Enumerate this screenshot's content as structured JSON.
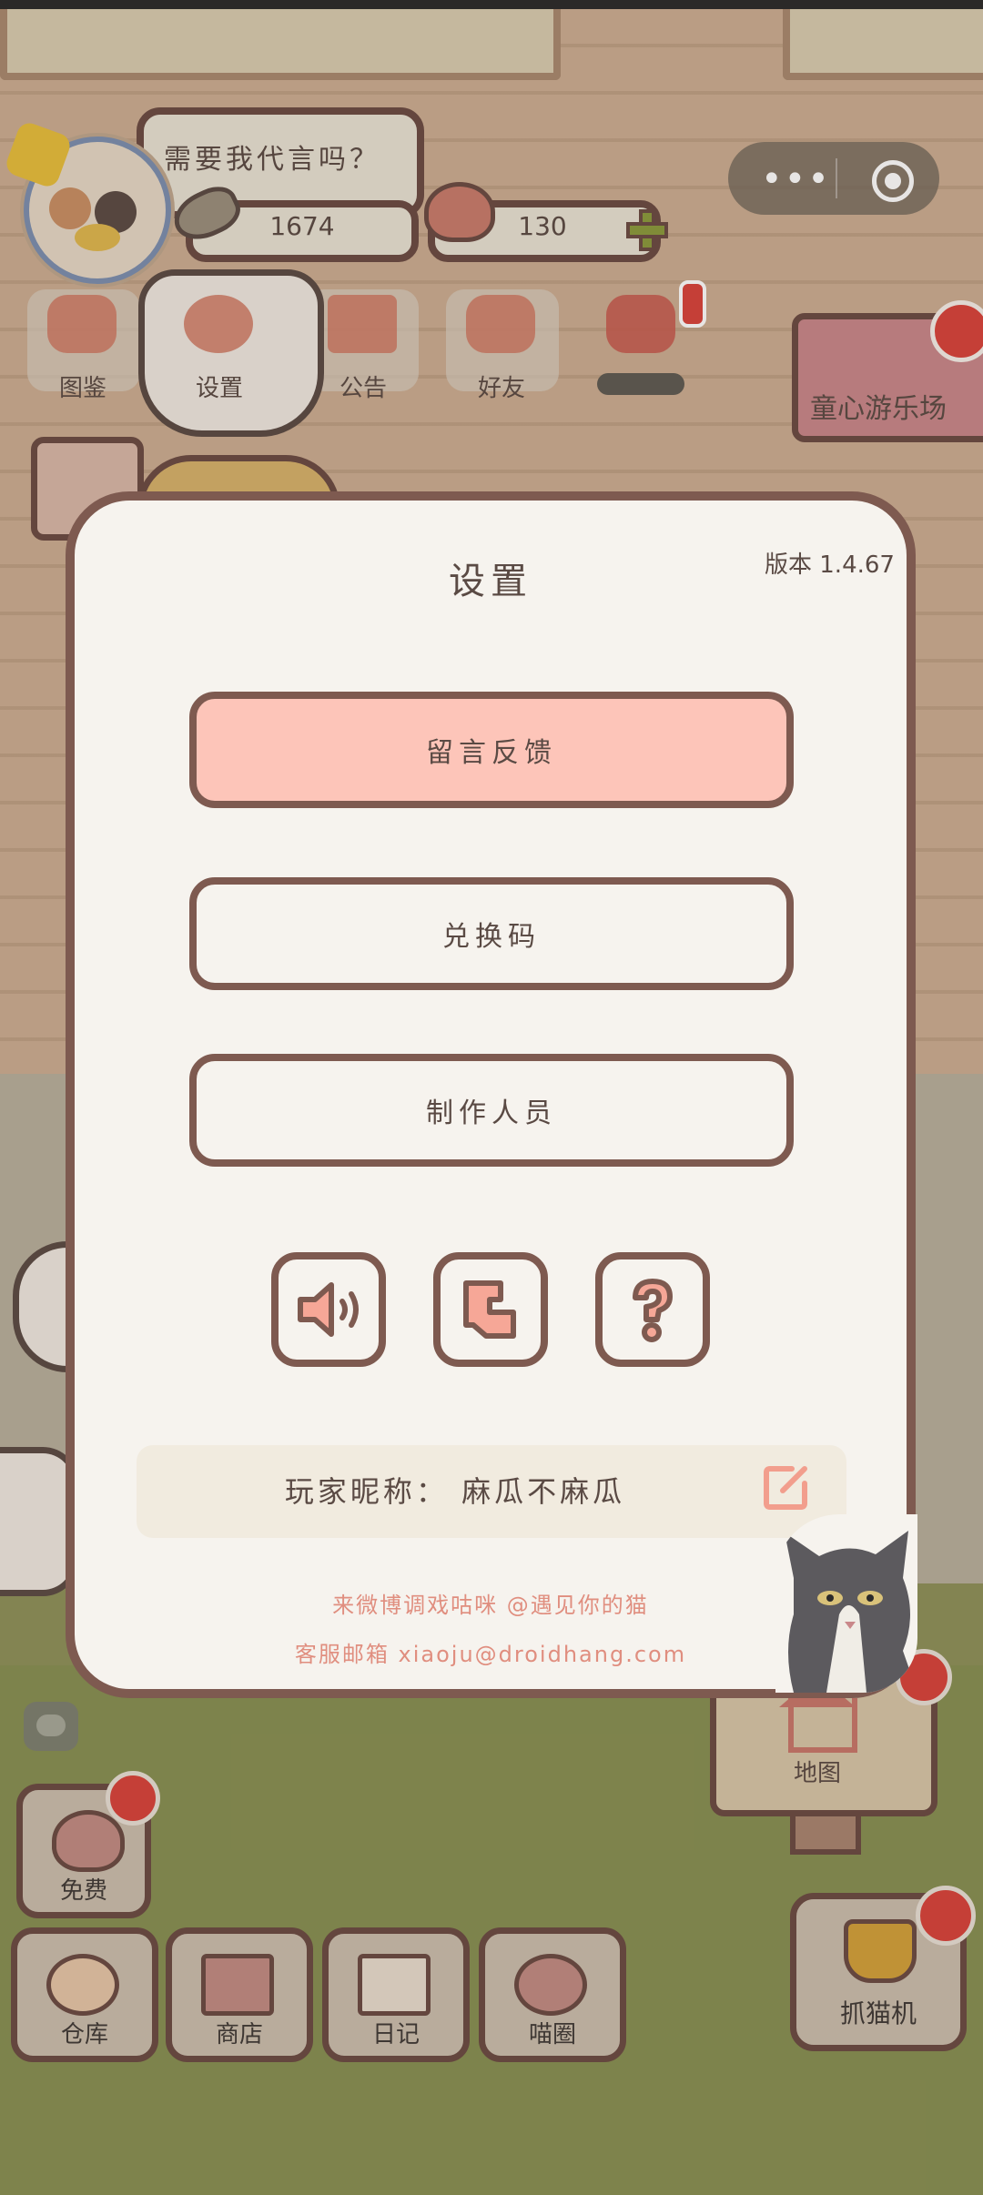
{
  "hud": {
    "speech": "需要我代言吗？",
    "fish_count": "1674",
    "heart_count": "130"
  },
  "nav": [
    {
      "label": "图鉴",
      "icon": "cat-book-icon"
    },
    {
      "label": "设置",
      "icon": "gear-icon"
    },
    {
      "label": "公告",
      "icon": "gift-icon"
    },
    {
      "label": "好友",
      "icon": "friends-icon"
    },
    {
      "label": "",
      "icon": "hearts-icon"
    }
  ],
  "banner": {
    "label": "童心游乐场"
  },
  "map_sign": {
    "label": "地图"
  },
  "bottom": [
    {
      "label": "免费",
      "icon": "heart-gift-icon"
    },
    {
      "label": "仓库",
      "icon": "storage-icon"
    },
    {
      "label": "商店",
      "icon": "shop-icon"
    },
    {
      "label": "日记",
      "icon": "diary-icon"
    },
    {
      "label": "喵圈",
      "icon": "planet-cat-icon"
    }
  ],
  "claw": {
    "label": "抓猫机"
  },
  "settings": {
    "title": "设置",
    "version": "版本 1.4.67",
    "buttons": {
      "feedback": "留言反馈",
      "redeem": "兑换码",
      "credits": "制作人员"
    },
    "icons": [
      "speaker-icon",
      "cursor-icon",
      "question-icon"
    ],
    "nickname": "玩家昵称： 麻瓜不麻瓜",
    "footer_weibo": "来微博调戏咕咪 @遇见你的猫",
    "footer_email": "客服邮箱 xiaoju@droidhang.com"
  },
  "colors": {
    "accent": "#fdc5b9",
    "border": "#7e5a50",
    "panel": "#f6f3ee",
    "alert": "#d9433b"
  }
}
